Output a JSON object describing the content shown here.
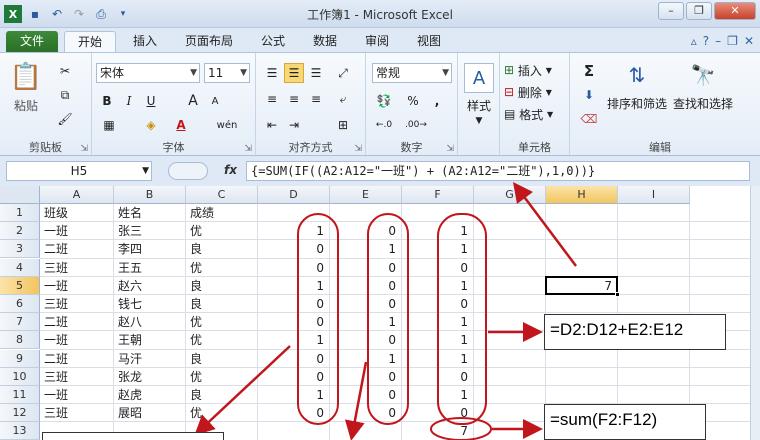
{
  "window": {
    "title": "工作簿1 - Microsoft Excel"
  },
  "tabs": [
    "文件",
    "开始",
    "插入",
    "页面布局",
    "公式",
    "数据",
    "审阅",
    "视图"
  ],
  "ribbon": {
    "clipboard": {
      "paste": "粘贴",
      "label": "剪贴板"
    },
    "font": {
      "name": "宋体",
      "size": "11",
      "bold": "B",
      "italic": "I",
      "underline": "U",
      "grow": "A",
      "shrink": "A",
      "wen": "wén",
      "label": "字体"
    },
    "alignment": {
      "label": "对齐方式"
    },
    "number": {
      "format": "常规",
      "percent": "%",
      "comma": ",",
      "label": "数字"
    },
    "styles": {
      "label": "样式"
    },
    "cells": {
      "insert": "插入",
      "delete": "删除",
      "format": "格式",
      "label": "单元格"
    },
    "editing": {
      "sigma": "Σ",
      "sort_filter": "排序和筛选",
      "find_select": "查找和选择",
      "label": "编辑"
    }
  },
  "formula_bar": {
    "name_box": "H5",
    "fx": "fx",
    "formula": "{=SUM(IF((A2:A12=\"一班\") + (A2:A12=\"二班\"),1,0))}"
  },
  "grid": {
    "columns": [
      "A",
      "B",
      "C",
      "D",
      "E",
      "F",
      "G",
      "H",
      "I"
    ],
    "selected_column": "H",
    "rows": [
      "1",
      "2",
      "3",
      "4",
      "5",
      "6",
      "7",
      "8",
      "9",
      "10",
      "11",
      "12",
      "13"
    ],
    "selected_row": "5",
    "header_row": {
      "a": "班级",
      "b": "姓名",
      "c": "成绩"
    },
    "data": [
      {
        "a": "一班",
        "b": "张三",
        "c": "优",
        "d": "1",
        "e": "0",
        "f": "1"
      },
      {
        "a": "二班",
        "b": "李四",
        "c": "良",
        "d": "0",
        "e": "1",
        "f": "1"
      },
      {
        "a": "三班",
        "b": "王五",
        "c": "优",
        "d": "0",
        "e": "0",
        "f": "0"
      },
      {
        "a": "一班",
        "b": "赵六",
        "c": "良",
        "d": "1",
        "e": "0",
        "f": "1"
      },
      {
        "a": "三班",
        "b": "钱七",
        "c": "良",
        "d": "0",
        "e": "0",
        "f": "0"
      },
      {
        "a": "二班",
        "b": "赵八",
        "c": "优",
        "d": "0",
        "e": "1",
        "f": "1"
      },
      {
        "a": "一班",
        "b": "王朝",
        "c": "优",
        "d": "1",
        "e": "0",
        "f": "1"
      },
      {
        "a": "二班",
        "b": "马汗",
        "c": "良",
        "d": "0",
        "e": "1",
        "f": "1"
      },
      {
        "a": "三班",
        "b": "张龙",
        "c": "优",
        "d": "0",
        "e": "0",
        "f": "0"
      },
      {
        "a": "一班",
        "b": "赵虎",
        "c": "良",
        "d": "1",
        "e": "0",
        "f": "1"
      },
      {
        "a": "三班",
        "b": "展昭",
        "c": "优",
        "d": "0",
        "e": "0",
        "f": "0"
      }
    ],
    "f13": "7",
    "h5": "7"
  },
  "annotations": {
    "note1": "=D2:D12+E2:E12",
    "note2": "=sum(F2:F12)",
    "color": "#c0161c"
  }
}
